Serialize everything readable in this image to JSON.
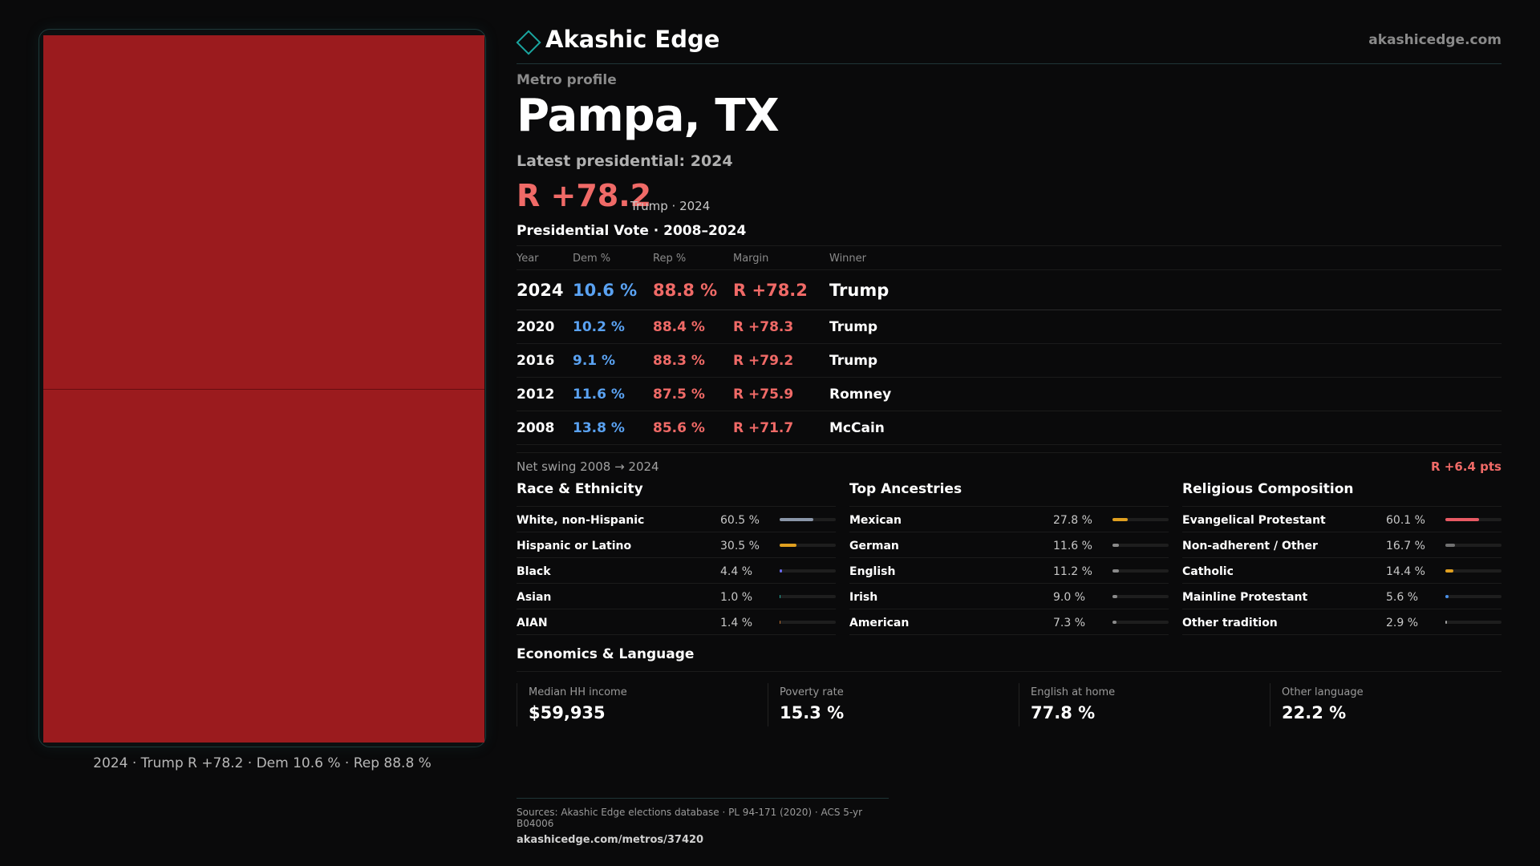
{
  "brand": {
    "name": "Akashic Edge",
    "url": "akashicedge.com",
    "accent": "#1aa6a0"
  },
  "map": {
    "fill_color": "#9b1b1e",
    "caption": "2024 · Trump R +78.2 · Dem 10.6 % · Rep 88.8 %"
  },
  "profile": {
    "eyebrow": "Metro profile",
    "title": "Pampa, TX",
    "latest": "Latest presidential: 2024",
    "margin": "R +78.2",
    "margin_sub": "Trump · 2024"
  },
  "votes": {
    "title": "Presidential Vote · 2008–2024",
    "headers": {
      "year": "Year",
      "dem": "Dem %",
      "rep": "Rep %",
      "margin": "Margin",
      "winner": "Winner"
    },
    "rows": [
      {
        "year": "2024",
        "dem": "10.6 %",
        "rep": "88.8 %",
        "margin": "R +78.2",
        "winner": "Trump"
      },
      {
        "year": "2020",
        "dem": "10.2 %",
        "rep": "88.4 %",
        "margin": "R +78.3",
        "winner": "Trump"
      },
      {
        "year": "2016",
        "dem": "9.1 %",
        "rep": "88.3 %",
        "margin": "R +79.2",
        "winner": "Trump"
      },
      {
        "year": "2012",
        "dem": "11.6 %",
        "rep": "87.5 %",
        "margin": "R +75.9",
        "winner": "Romney"
      },
      {
        "year": "2008",
        "dem": "13.8 %",
        "rep": "85.6 %",
        "margin": "R +71.7",
        "winner": "McCain"
      }
    ],
    "swing_label": "Net swing 2008 → 2024",
    "swing_value": "R +6.4 pts"
  },
  "race": {
    "title": "Race & Ethnicity",
    "items": [
      {
        "label": "White, non-Hispanic",
        "value": "60.5 %",
        "pct": 60.5,
        "color": "#8a96a8"
      },
      {
        "label": "Hispanic or Latino",
        "value": "30.5 %",
        "pct": 30.5,
        "color": "#e0a020"
      },
      {
        "label": "Black",
        "value": "4.4 %",
        "pct": 4.4,
        "color": "#6a6af0"
      },
      {
        "label": "Asian",
        "value": "1.0 %",
        "pct": 1.0,
        "color": "#20b0a0"
      },
      {
        "label": "AIAN",
        "value": "1.4 %",
        "pct": 1.4,
        "color": "#c07030"
      }
    ]
  },
  "ancestry": {
    "title": "Top Ancestries",
    "items": [
      {
        "label": "Mexican",
        "value": "27.8 %",
        "pct": 27.8,
        "color": "#e0a020"
      },
      {
        "label": "German",
        "value": "11.6 %",
        "pct": 11.6,
        "color": "#8a8a8a"
      },
      {
        "label": "English",
        "value": "11.2 %",
        "pct": 11.2,
        "color": "#8a8a8a"
      },
      {
        "label": "Irish",
        "value": "9.0 %",
        "pct": 9.0,
        "color": "#8a8a8a"
      },
      {
        "label": "American",
        "value": "7.3 %",
        "pct": 7.3,
        "color": "#8a8a8a"
      }
    ]
  },
  "religion": {
    "title": "Religious Composition",
    "items": [
      {
        "label": "Evangelical Protestant",
        "value": "60.1 %",
        "pct": 60.1,
        "color": "#e85a64"
      },
      {
        "label": "Non-adherent / Other",
        "value": "16.7 %",
        "pct": 16.7,
        "color": "#707070"
      },
      {
        "label": "Catholic",
        "value": "14.4 %",
        "pct": 14.4,
        "color": "#e0a020"
      },
      {
        "label": "Mainline Protestant",
        "value": "5.6 %",
        "pct": 5.6,
        "color": "#4a90e8"
      },
      {
        "label": "Other tradition",
        "value": "2.9 %",
        "pct": 2.9,
        "color": "#a0a0a0"
      }
    ]
  },
  "economics": {
    "title": "Economics & Language",
    "cards": [
      {
        "label": "Median HH income",
        "value": "$59,935"
      },
      {
        "label": "Poverty rate",
        "value": "15.3 %"
      },
      {
        "label": "English at home",
        "value": "77.8 %"
      },
      {
        "label": "Other language",
        "value": "22.2 %"
      }
    ]
  },
  "sources": {
    "line": "Sources: Akashic Edge elections database · PL 94-171 (2020) · ACS 5-yr B04006",
    "url": "akashicedge.com/metros/37420"
  }
}
